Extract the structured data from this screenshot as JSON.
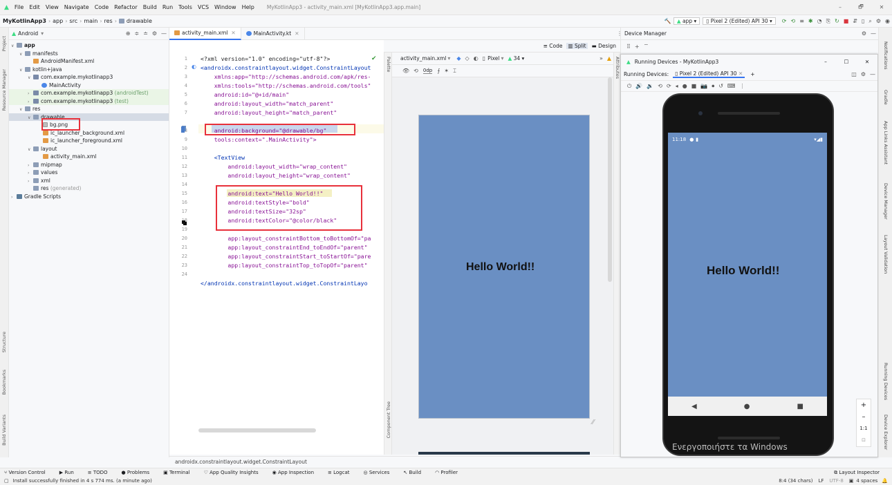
{
  "window": {
    "title": "MyKotlinApp3 - activity_main.xml [MyKotlinApp3.app.main]",
    "menu": [
      "File",
      "Edit",
      "View",
      "Navigate",
      "Code",
      "Refactor",
      "Build",
      "Run",
      "Tools",
      "VCS",
      "Window",
      "Help"
    ],
    "minimize": "–",
    "maximize": "🗗",
    "close": "✕"
  },
  "breadcrumb": [
    "MyKotlinApp3",
    "app",
    "src",
    "main",
    "res",
    "drawable"
  ],
  "toolbar": {
    "run_config": "app",
    "device": "Pixel 2 (Edited) API 30"
  },
  "project": {
    "view": "Android",
    "items": [
      {
        "label": "app",
        "bold": true
      },
      {
        "label": "manifests"
      },
      {
        "label": "AndroidManifest.xml"
      },
      {
        "label": "kotlin+java"
      },
      {
        "label": "com.example.mykotlinapp3"
      },
      {
        "label": "MainActivity"
      },
      {
        "label": "com.example.mykotlinapp3",
        "suffix": "(androidTest)"
      },
      {
        "label": "com.example.mykotlinapp3",
        "suffix": "(test)"
      },
      {
        "label": "res"
      },
      {
        "label": "drawable"
      },
      {
        "label": "bg.png"
      },
      {
        "label": "ic_launcher_background.xml"
      },
      {
        "label": "ic_launcher_foreground.xml"
      },
      {
        "label": "layout"
      },
      {
        "label": "activity_main.xml"
      },
      {
        "label": "mipmap"
      },
      {
        "label": "values"
      },
      {
        "label": "xml"
      },
      {
        "label": "res",
        "suffix": "(generated)"
      },
      {
        "label": "Gradle Scripts"
      }
    ]
  },
  "editor": {
    "tabs": [
      "activity_main.xml",
      "MainActivity.kt"
    ],
    "view_modes": [
      "Code",
      "Split",
      "Design"
    ],
    "lines": [
      "<?xml version=\"1.0\" encoding=\"utf-8\"?>",
      "<androidx.constraintlayout.widget.ConstraintLayout",
      "    xmlns:app=\"http://schemas.android.com/apk/res-",
      "    xmlns:tools=\"http://schemas.android.com/tools\"",
      "    android:id=\"@+id/main\"",
      "    android:layout_width=\"match_parent\"",
      "    android:layout_height=\"match_parent\"",
      "    android:background=\"@drawable/bg\"",
      "    tools:context=\".MainActivity\">",
      "",
      "    <TextView",
      "        android:layout_width=\"wrap_content\"",
      "        android:layout_height=\"wrap_content\"",
      "        android:text=\"Hello World!!\"",
      "        android:textStyle=\"bold\"",
      "        android:textSize=\"32sp\"",
      "        android:textColor=\"@color/black\"",
      "",
      "        app:layout_constraintBottom_toBottomOf=\"pa",
      "        app:layout_constraintEnd_toEndOf=\"parent\"",
      "        app:layout_constraintStart_toStartOf=\"pare",
      "        app:layout_constraintTop_toTopOf=\"parent\"",
      "",
      "</androidx.constraintlayout.widget.ConstraintLayo"
    ],
    "line_numbers": [
      "1",
      "2",
      "3",
      "4",
      "5",
      "6",
      "7",
      "8",
      "9",
      "10",
      "11",
      "12",
      "13",
      "14",
      "15",
      "16",
      "17",
      "18",
      "19",
      "20",
      "21",
      "22",
      "23",
      "24"
    ],
    "status_path": "androidx.constraintlayout.widget.ConstraintLayout"
  },
  "design": {
    "file": "activity_main.xml",
    "device": "Pixel",
    "api": "34",
    "margin": "0dp",
    "preview_text": "Hello World!!",
    "palette": "Palette",
    "component_tree": "Component Tree",
    "attributes": "Attributes"
  },
  "device_manager": {
    "title": "Device Manager",
    "window_title": "Running Devices - MyKotlinApp3",
    "running_label": "Running Devices:",
    "device_tab": "Pixel 2 (Edited) API 30",
    "phone_time": "11:18",
    "phone_text": "Hello World!!",
    "watermark_line1": "Ενεργοποιήστε τα Windows",
    "zoom_controls": [
      "+",
      "–",
      "1:1"
    ]
  },
  "right_tools": [
    "Notifications",
    "Gradle",
    "App Links Assistant",
    "Device Manager",
    "Layout Validation",
    "Running Devices",
    "Device Explorer"
  ],
  "left_tools": [
    "Project",
    "Resource Manager",
    "Structure",
    "Bookmarks",
    "Build Variants"
  ],
  "bottom_tools": [
    "Version Control",
    "Run",
    "TODO",
    "Problems",
    "Terminal",
    "App Quality Insights",
    "App Inspection",
    "Logcat",
    "Services",
    "Build",
    "Profiler"
  ],
  "layout_inspector": "Layout Inspector",
  "status": {
    "message": "Install successfully finished in 4 s 774 ms. (a minute ago)",
    "position": "8:4 (34 chars)",
    "line_sep": "LF",
    "encoding": "UTF-8",
    "indent": "4 spaces"
  },
  "colors": {
    "accent": "#3574f0",
    "preview_bg": "#6a8fc3",
    "highlight": "#e8303a"
  }
}
